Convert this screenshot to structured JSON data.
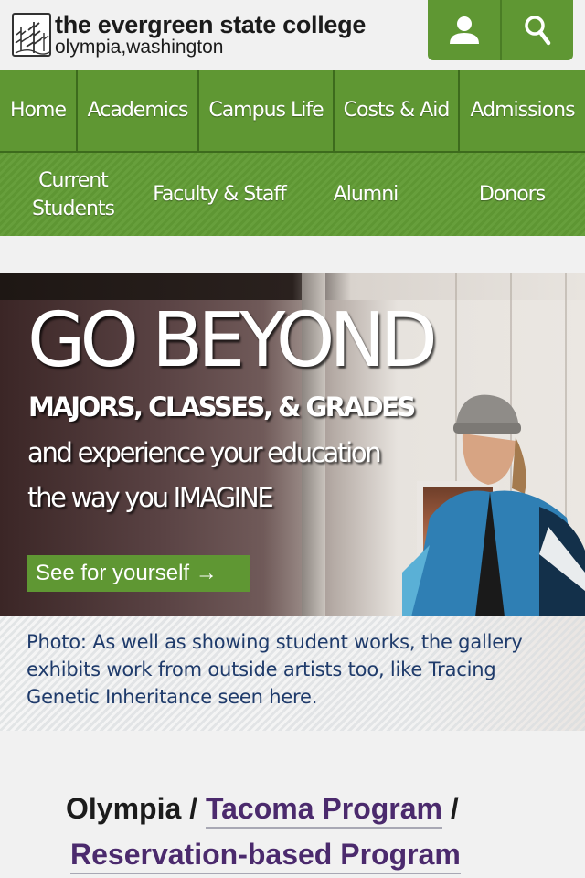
{
  "header": {
    "college_name": "the evergreen state college",
    "location": "olympia,washington",
    "buttons": [
      {
        "name": "account",
        "icon": "person-icon"
      },
      {
        "name": "search",
        "icon": "search-icon"
      }
    ]
  },
  "nav": {
    "primary": [
      "Home",
      "Academics",
      "Campus Life",
      "Costs & Aid",
      "Admissions"
    ],
    "secondary": [
      "Current\nStudents",
      "Faculty & Staff",
      "Alumni",
      "Donors"
    ]
  },
  "hero": {
    "headline": "GO BEYOND",
    "line1": "MAJORS, CLASSES, & GRADES",
    "line2": "and experience your education",
    "line3": "the way you IMAGINE",
    "cta": "See for yourself →"
  },
  "caption": "Photo: As well as showing student works, the gallery exhibits work from outside artists too, like Tracing Genetic Inheritance seen here.",
  "campus": {
    "current": "Olympia",
    "separator": " / ",
    "trailing_separator": " /",
    "links": [
      "Tacoma Program",
      "Reservation-based Program"
    ]
  },
  "colors": {
    "brand_green": "#5f9733",
    "link_purple": "#4b2a6d",
    "caption_blue": "#1f3b6b"
  }
}
